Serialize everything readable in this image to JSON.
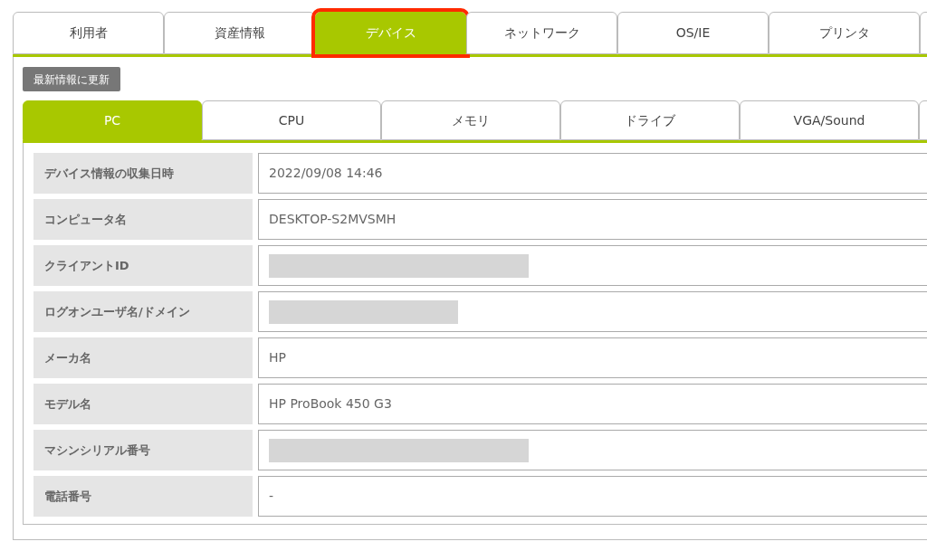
{
  "main_tabs": [
    {
      "label": "利用者",
      "selected": false,
      "highlighted": false
    },
    {
      "label": "資産情報",
      "selected": false,
      "highlighted": false
    },
    {
      "label": "デバイス",
      "selected": true,
      "highlighted": true
    },
    {
      "label": "ネットワーク",
      "selected": false,
      "highlighted": false
    },
    {
      "label": "OS/IE",
      "selected": false,
      "highlighted": false
    },
    {
      "label": "プリンタ",
      "selected": false,
      "highlighted": false
    }
  ],
  "refresh_button": "最新情報に更新",
  "sub_tabs": [
    {
      "label": "PC",
      "selected": true
    },
    {
      "label": "CPU",
      "selected": false
    },
    {
      "label": "メモリ",
      "selected": false
    },
    {
      "label": "ドライブ",
      "selected": false
    },
    {
      "label": "VGA/Sound",
      "selected": false
    }
  ],
  "rows": [
    {
      "label": "デバイス情報の収集日時",
      "kind": "text",
      "value": "2022/09/08 14:46"
    },
    {
      "label": "コンピュータ名",
      "kind": "text",
      "value": "DESKTOP-S2MVSMH"
    },
    {
      "label": "クライアントID",
      "kind": "redacted_long"
    },
    {
      "label": "ログオンユーザ名/ドメイン",
      "kind": "redacted_short"
    },
    {
      "label": "メーカ名",
      "kind": "text",
      "value": "HP"
    },
    {
      "label": "モデル名",
      "kind": "text",
      "value": "HP ProBook 450 G3"
    },
    {
      "label": "マシンシリアル番号",
      "kind": "redacted_long"
    },
    {
      "label": "電話番号",
      "kind": "text",
      "value": "-"
    }
  ]
}
